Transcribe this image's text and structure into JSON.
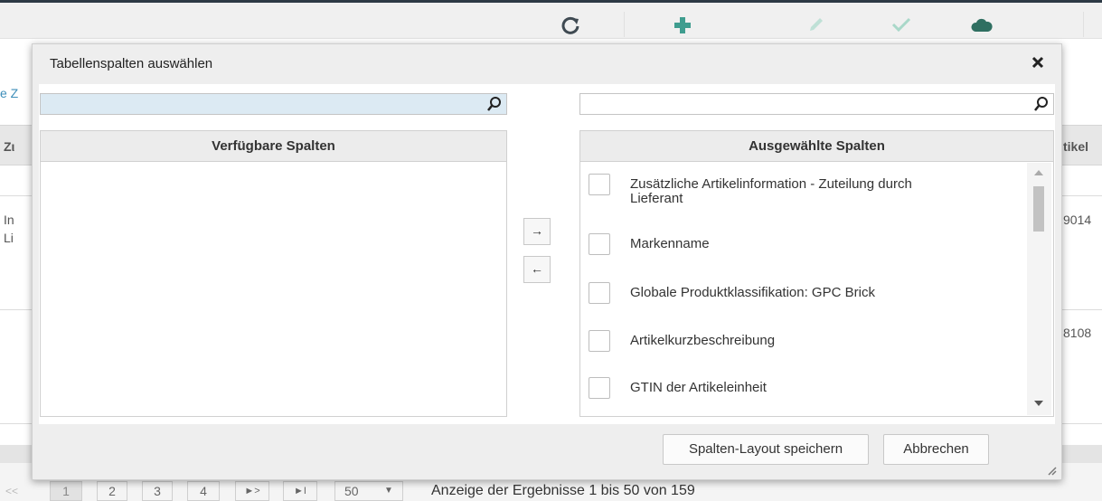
{
  "background": {
    "toolbar_icons": [
      "refresh-icon",
      "plus-icon",
      "pencil-icon",
      "check-icon",
      "cloud-icon"
    ],
    "fragments": {
      "left_link": "e Z",
      "left_header": "Zι",
      "row1_line1": "In",
      "row1_line2": "Li",
      "right_header": "tikel",
      "right_row1": "9014",
      "right_row2": "8108"
    },
    "pager": {
      "first": "<<",
      "pages": [
        "1",
        "2",
        "3",
        "4"
      ],
      "next": "►>",
      "last": "►I",
      "page_size": "50",
      "page_size_arrow": "▼",
      "info": "Anzeige der Ergebnisse 1 bis 50 von 159"
    },
    "colors": {
      "accent": "#3d8eb9",
      "toolbar_icon": "#4a9a8c"
    }
  },
  "dialog": {
    "title": "Tabellenspalten auswählen",
    "close_icon": "close-icon",
    "left": {
      "search_value": "",
      "header": "Verfügbare Spalten",
      "items": []
    },
    "right": {
      "search_value": "",
      "header": "Ausgewählte Spalten",
      "items": [
        {
          "label_line1": "Zusätzliche Artikelinformation - Zuteilung durch",
          "label_line2": "Lieferant",
          "checked": false
        },
        {
          "label_line1": "Markenname",
          "label_line2": "",
          "checked": false
        },
        {
          "label_line1": "Globale Produktklassifikation: GPC Brick",
          "label_line2": "",
          "checked": false
        },
        {
          "label_line1": "Artikelkurzbeschreibung",
          "label_line2": "",
          "checked": false
        },
        {
          "label_line1": "GTIN der Artikeleinheit",
          "label_line2": "",
          "checked": false
        }
      ]
    },
    "move_right_label": "→",
    "move_left_label": "←",
    "save_label": "Spalten-Layout speichern",
    "cancel_label": "Abbrechen"
  }
}
